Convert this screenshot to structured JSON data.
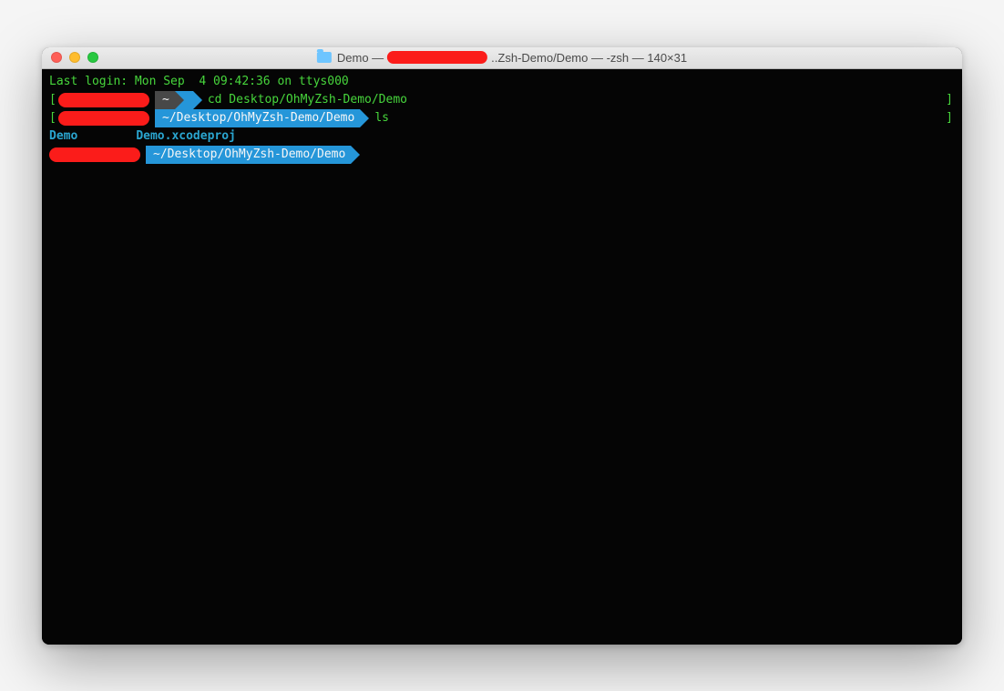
{
  "titlebar": {
    "prefix": "Demo —",
    "suffix": " ..Zsh-Demo/Demo — -zsh — 140×31"
  },
  "terminal": {
    "login_line": "Last login: Mon Sep  4 09:42:36 on ttys000",
    "bracket_open": "[",
    "bracket_close": "]",
    "lines": [
      {
        "home_seg": "~",
        "command": "cd Desktop/OhMyZsh-Demo/Demo"
      },
      {
        "path_seg": "~/Desktop/OhMyZsh-Demo/Demo",
        "command": "ls"
      }
    ],
    "ls_output": {
      "item1": "Demo",
      "item2": "Demo.xcodeproj"
    },
    "prompt3": {
      "path_seg": "~/Desktop/OhMyZsh-Demo/Demo"
    }
  }
}
